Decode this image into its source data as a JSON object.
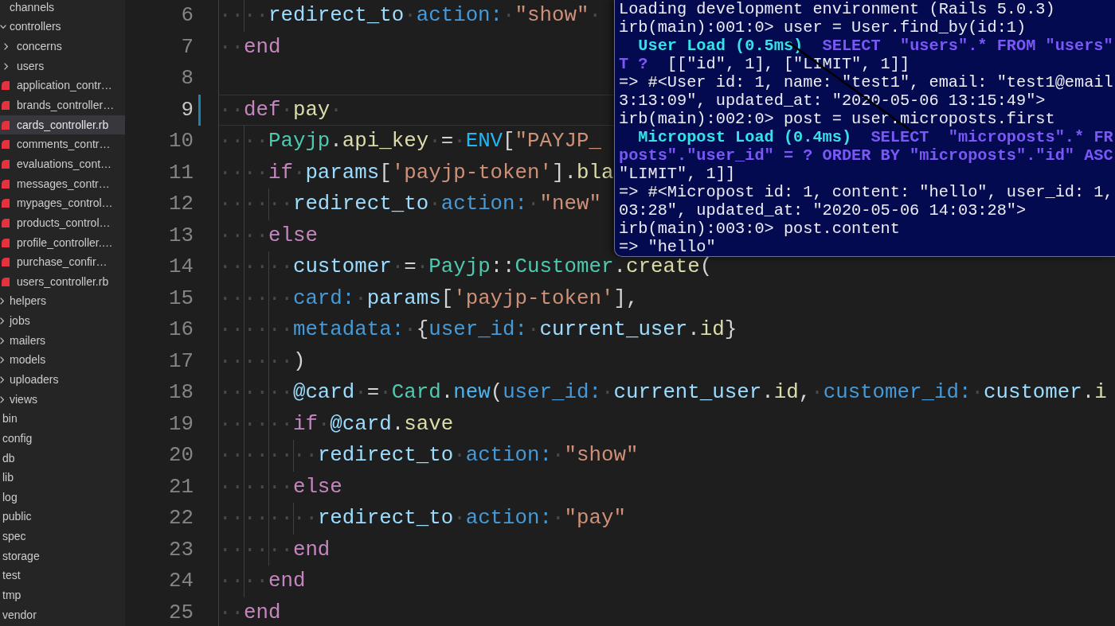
{
  "explorer": {
    "tree": [
      {
        "kind": "group",
        "children": [
          {
            "kind": "entry",
            "label": "channels",
            "selected": false
          },
          {
            "kind": "folder",
            "label": "controllers",
            "expanded": true,
            "selected": false,
            "children": [
              {
                "kind": "folder",
                "label": "concerns",
                "expanded": false,
                "selected": false
              },
              {
                "kind": "folder",
                "label": "users",
                "expanded": false,
                "selected": false
              },
              {
                "kind": "ruby-file",
                "label": "application_contr…",
                "selected": false
              },
              {
                "kind": "ruby-file",
                "label": "brands_controller…",
                "selected": false
              },
              {
                "kind": "ruby-file",
                "label": "cards_controller.rb",
                "selected": true
              },
              {
                "kind": "ruby-file",
                "label": "comments_contr…",
                "selected": false
              },
              {
                "kind": "ruby-file",
                "label": "evaluations_cont…",
                "selected": false
              },
              {
                "kind": "ruby-file",
                "label": "messages_contr…",
                "selected": false
              },
              {
                "kind": "ruby-file",
                "label": "mypages_control…",
                "selected": false
              },
              {
                "kind": "ruby-file",
                "label": "products_control…",
                "selected": false
              },
              {
                "kind": "ruby-file",
                "label": "profile_controller.…",
                "selected": false
              },
              {
                "kind": "ruby-file",
                "label": "purchase_confir…",
                "selected": false
              },
              {
                "kind": "ruby-file",
                "label": "users_controller.rb",
                "selected": false
              }
            ]
          },
          {
            "kind": "folder",
            "label": "helpers",
            "expanded": false,
            "selected": false
          },
          {
            "kind": "folder",
            "label": "jobs",
            "expanded": false,
            "selected": false
          },
          {
            "kind": "folder",
            "label": "mailers",
            "expanded": false,
            "selected": false
          },
          {
            "kind": "folder",
            "label": "models",
            "expanded": false,
            "selected": false
          },
          {
            "kind": "folder",
            "label": "uploaders",
            "expanded": false,
            "selected": false
          },
          {
            "kind": "folder",
            "label": "views",
            "expanded": false,
            "selected": false
          }
        ]
      },
      {
        "kind": "entry",
        "label": "bin",
        "selected": false
      },
      {
        "kind": "entry",
        "label": "config",
        "selected": false
      },
      {
        "kind": "entry",
        "label": "db",
        "selected": false
      },
      {
        "kind": "entry",
        "label": "lib",
        "selected": false
      },
      {
        "kind": "entry",
        "label": "log",
        "selected": false
      },
      {
        "kind": "entry",
        "label": "public",
        "selected": false
      },
      {
        "kind": "entry",
        "label": "spec",
        "selected": false
      },
      {
        "kind": "entry",
        "label": "storage",
        "selected": false
      },
      {
        "kind": "entry",
        "label": "test",
        "selected": false
      },
      {
        "kind": "entry",
        "label": "tmp",
        "selected": false
      },
      {
        "kind": "entry",
        "label": "vendor",
        "selected": false
      }
    ]
  },
  "editor": {
    "lines": [
      {
        "number": "6",
        "current": false,
        "modified": false,
        "tokens": [
          {
            "kind": "indent",
            "text": "····"
          },
          {
            "kind": "variable",
            "text": "redirect_to"
          },
          {
            "kind": "space",
            "text": "·"
          },
          {
            "kind": "symbol",
            "text": "action:"
          },
          {
            "kind": "space",
            "text": "·"
          },
          {
            "kind": "string",
            "text": "\"show\""
          },
          {
            "kind": "space",
            "text": "·"
          }
        ]
      },
      {
        "number": "7",
        "current": false,
        "modified": false,
        "tokens": [
          {
            "kind": "indent",
            "text": "··"
          },
          {
            "kind": "keyword",
            "text": "end"
          }
        ]
      },
      {
        "number": "8",
        "current": false,
        "modified": false
      },
      {
        "number": "9",
        "current": true,
        "modified": true,
        "tokens": [
          {
            "kind": "indent",
            "text": "··"
          },
          {
            "kind": "keyword",
            "text": "def"
          },
          {
            "kind": "space",
            "text": "·"
          },
          {
            "kind": "function",
            "text": "pay"
          },
          {
            "kind": "space",
            "text": "·"
          }
        ]
      },
      {
        "number": "10",
        "current": false,
        "modified": false,
        "tokens": [
          {
            "kind": "indent",
            "text": "····"
          },
          {
            "kind": "constant",
            "text": "Payjp"
          },
          {
            "kind": "punct",
            "text": "."
          },
          {
            "kind": "function",
            "text": "api_key"
          },
          {
            "kind": "space",
            "text": "·"
          },
          {
            "kind": "punct",
            "text": "="
          },
          {
            "kind": "space",
            "text": "·"
          },
          {
            "kind": "builtin",
            "text": "ENV"
          },
          {
            "kind": "punct",
            "text": "["
          },
          {
            "kind": "string",
            "text": "\"PAYJP_"
          }
        ]
      },
      {
        "number": "11",
        "current": false,
        "modified": false,
        "tokens": [
          {
            "kind": "indent",
            "text": "····"
          },
          {
            "kind": "keyword",
            "text": "if"
          },
          {
            "kind": "space",
            "text": "·"
          },
          {
            "kind": "variable",
            "text": "params"
          },
          {
            "kind": "punct",
            "text": "["
          },
          {
            "kind": "string",
            "text": "'payjp-token'"
          },
          {
            "kind": "punct",
            "text": "]."
          },
          {
            "kind": "function",
            "text": "bla"
          }
        ]
      },
      {
        "number": "12",
        "current": false,
        "modified": false,
        "tokens": [
          {
            "kind": "indent",
            "text": "······"
          },
          {
            "kind": "variable",
            "text": "redirect_to"
          },
          {
            "kind": "space",
            "text": "·"
          },
          {
            "kind": "symbol",
            "text": "action:"
          },
          {
            "kind": "space",
            "text": "·"
          },
          {
            "kind": "string",
            "text": "\"new\""
          }
        ]
      },
      {
        "number": "13",
        "current": false,
        "modified": false,
        "tokens": [
          {
            "kind": "indent",
            "text": "····"
          },
          {
            "kind": "keyword",
            "text": "else"
          }
        ]
      },
      {
        "number": "14",
        "current": false,
        "modified": false,
        "tokens": [
          {
            "kind": "indent",
            "text": "······"
          },
          {
            "kind": "variable",
            "text": "customer"
          },
          {
            "kind": "space",
            "text": "·"
          },
          {
            "kind": "punct",
            "text": "="
          },
          {
            "kind": "space",
            "text": "·"
          },
          {
            "kind": "constant",
            "text": "Payjp"
          },
          {
            "kind": "punct",
            "text": "::"
          },
          {
            "kind": "constant",
            "text": "Customer"
          },
          {
            "kind": "punct",
            "text": "."
          },
          {
            "kind": "function",
            "text": "create"
          },
          {
            "kind": "punct",
            "text": "("
          }
        ]
      },
      {
        "number": "15",
        "current": false,
        "modified": false,
        "tokens": [
          {
            "kind": "indent",
            "text": "······"
          },
          {
            "kind": "symbol",
            "text": "card:"
          },
          {
            "kind": "space",
            "text": "·"
          },
          {
            "kind": "variable",
            "text": "params"
          },
          {
            "kind": "punct",
            "text": "["
          },
          {
            "kind": "string",
            "text": "'payjp-token'"
          },
          {
            "kind": "punct",
            "text": "],"
          }
        ]
      },
      {
        "number": "16",
        "current": false,
        "modified": false,
        "tokens": [
          {
            "kind": "indent",
            "text": "······"
          },
          {
            "kind": "symbol",
            "text": "metadata:"
          },
          {
            "kind": "space",
            "text": "·"
          },
          {
            "kind": "punct",
            "text": "{"
          },
          {
            "kind": "symbol",
            "text": "user_id:"
          },
          {
            "kind": "space",
            "text": "·"
          },
          {
            "kind": "variable",
            "text": "current_user"
          },
          {
            "kind": "punct",
            "text": "."
          },
          {
            "kind": "function",
            "text": "id"
          },
          {
            "kind": "punct",
            "text": "}"
          }
        ]
      },
      {
        "number": "17",
        "current": false,
        "modified": false,
        "tokens": [
          {
            "kind": "indent",
            "text": "······"
          },
          {
            "kind": "punct",
            "text": ")"
          }
        ]
      },
      {
        "number": "18",
        "current": false,
        "modified": false,
        "tokens": [
          {
            "kind": "indent",
            "text": "······"
          },
          {
            "kind": "variable",
            "text": "@card"
          },
          {
            "kind": "space",
            "text": "·"
          },
          {
            "kind": "punct",
            "text": "="
          },
          {
            "kind": "space",
            "text": "·"
          },
          {
            "kind": "constant",
            "text": "Card"
          },
          {
            "kind": "punct",
            "text": "."
          },
          {
            "kind": "special",
            "text": "new"
          },
          {
            "kind": "punct",
            "text": "("
          },
          {
            "kind": "symbol",
            "text": "user_id:"
          },
          {
            "kind": "space",
            "text": "·"
          },
          {
            "kind": "variable",
            "text": "current_user"
          },
          {
            "kind": "punct",
            "text": "."
          },
          {
            "kind": "function",
            "text": "id"
          },
          {
            "kind": "punct",
            "text": ","
          },
          {
            "kind": "space",
            "text": "·"
          },
          {
            "kind": "symbol",
            "text": "customer_id:"
          },
          {
            "kind": "space",
            "text": "·"
          },
          {
            "kind": "variable",
            "text": "customer"
          },
          {
            "kind": "punct",
            "text": "."
          },
          {
            "kind": "function",
            "text": "i"
          }
        ]
      },
      {
        "number": "19",
        "current": false,
        "modified": false,
        "tokens": [
          {
            "kind": "indent",
            "text": "······"
          },
          {
            "kind": "keyword",
            "text": "if"
          },
          {
            "kind": "space",
            "text": "·"
          },
          {
            "kind": "variable",
            "text": "@card"
          },
          {
            "kind": "punct",
            "text": "."
          },
          {
            "kind": "function",
            "text": "save"
          }
        ]
      },
      {
        "number": "20",
        "current": false,
        "modified": false,
        "tokens": [
          {
            "kind": "indent",
            "text": "········"
          },
          {
            "kind": "variable",
            "text": "redirect_to"
          },
          {
            "kind": "space",
            "text": "·"
          },
          {
            "kind": "symbol",
            "text": "action:"
          },
          {
            "kind": "space",
            "text": "·"
          },
          {
            "kind": "string",
            "text": "\"show\""
          }
        ]
      },
      {
        "number": "21",
        "current": false,
        "modified": false,
        "tokens": [
          {
            "kind": "indent",
            "text": "······"
          },
          {
            "kind": "keyword",
            "text": "else"
          }
        ]
      },
      {
        "number": "22",
        "current": false,
        "modified": false,
        "tokens": [
          {
            "kind": "indent",
            "text": "········"
          },
          {
            "kind": "variable",
            "text": "redirect_to"
          },
          {
            "kind": "space",
            "text": "·"
          },
          {
            "kind": "symbol",
            "text": "action:"
          },
          {
            "kind": "space",
            "text": "·"
          },
          {
            "kind": "string",
            "text": "\"pay\""
          }
        ]
      },
      {
        "number": "23",
        "current": false,
        "modified": false,
        "tokens": [
          {
            "kind": "indent",
            "text": "······"
          },
          {
            "kind": "keyword",
            "text": "end"
          }
        ]
      },
      {
        "number": "24",
        "current": false,
        "modified": false,
        "tokens": [
          {
            "kind": "indent",
            "text": "····"
          },
          {
            "kind": "keyword",
            "text": "end"
          }
        ]
      },
      {
        "number": "25",
        "current": false,
        "modified": false,
        "tokens": [
          {
            "kind": "indent",
            "text": "··"
          },
          {
            "kind": "keyword",
            "text": "end"
          }
        ]
      }
    ]
  },
  "terminal": {
    "lines": [
      {
        "spans": [
          {
            "kind": "output",
            "text": "Loading development environment (Rails 5.0.3)"
          }
        ]
      },
      {
        "spans": [
          {
            "kind": "output",
            "text": "irb(main):001:0> user = User.find_by(id:1)"
          }
        ]
      },
      {
        "spans": [
          {
            "kind": "log",
            "text": "  User Load (0.5ms)"
          },
          {
            "kind": "sql",
            "text": "  SELECT  \"users\".* FROM \"users\""
          }
        ]
      },
      {
        "spans": [
          {
            "kind": "sql",
            "text": "T ?"
          },
          {
            "kind": "output",
            "text": "  [[\"id\", 1], [\"LIMIT\", 1]]"
          }
        ]
      },
      {
        "spans": [
          {
            "kind": "output",
            "text": "=> #<User id: 1, name: \"test1\", email: \"test1@email"
          }
        ]
      },
      {
        "spans": [
          {
            "kind": "output",
            "text": "3:13:09\", updated_at: \"2020-05-06 13:15:49\">"
          }
        ]
      },
      {
        "spans": [
          {
            "kind": "output",
            "text": "irb(main):002:0> post = user.microposts.first"
          }
        ]
      },
      {
        "spans": [
          {
            "kind": "log",
            "text": "  Micropost Load (0.4ms)"
          },
          {
            "kind": "sql",
            "text": "  SELECT  \"microposts\".* FR"
          }
        ]
      },
      {
        "spans": [
          {
            "kind": "sql",
            "text": "posts\".\"user_id\" = ? ORDER BY \"microposts\".\"id\" ASC"
          }
        ]
      },
      {
        "spans": [
          {
            "kind": "output",
            "text": "\"LIMIT\", 1]]"
          }
        ]
      },
      {
        "spans": [
          {
            "kind": "output",
            "text": "=> #<Micropost id: 1, content: \"hello\", user_id: 1,"
          }
        ]
      },
      {
        "spans": [
          {
            "kind": "output",
            "text": "03:28\", updated_at: \"2020-05-06 14:03:28\">"
          }
        ]
      },
      {
        "spans": [
          {
            "kind": "output",
            "text": "irb(main):003:0> post.content"
          }
        ]
      },
      {
        "spans": [
          {
            "kind": "output",
            "text": "=> \"hello\""
          }
        ]
      }
    ]
  }
}
